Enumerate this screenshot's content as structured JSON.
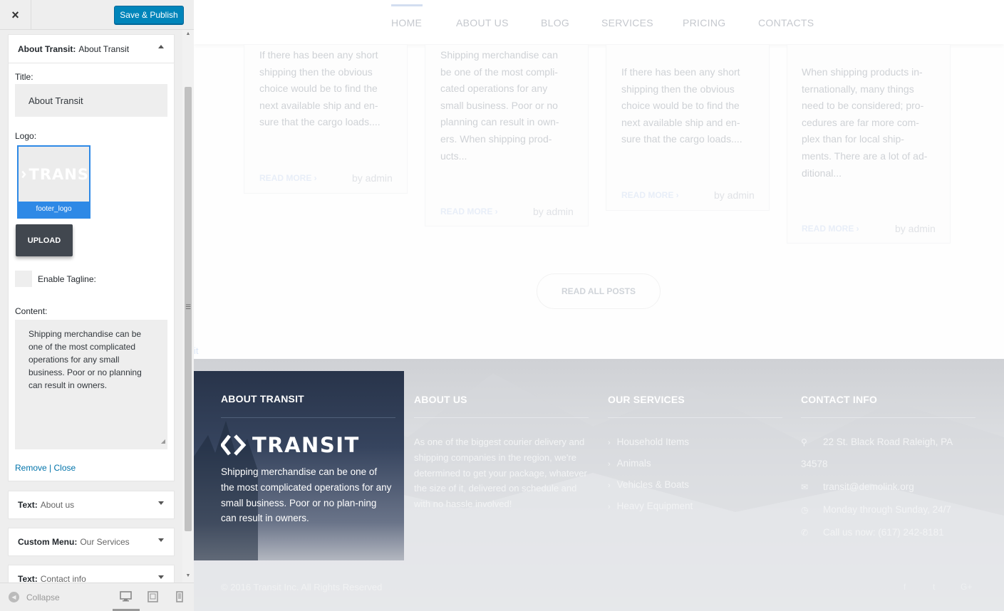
{
  "sidebar": {
    "close_label": "×",
    "publish_label": "Save & Publish",
    "widgets": {
      "about": {
        "type_label": "About Transit:",
        "name": "About Transit",
        "title_label": "Title:",
        "title_value": "About Transit",
        "logo_label": "Logo:",
        "logo_filename": "footer_logo",
        "logo_preview_text": "TRANS",
        "upload_label": "UPLOAD",
        "tagline_label": "Enable Tagline:",
        "tagline_checked": false,
        "content_label": "Content:",
        "content_value": "Shipping merchandise can be one of the most complicated operations for any small business. Poor or no planning can result in owners.",
        "remove_label": "Remove",
        "separator": "|",
        "close_label": "Close"
      },
      "text_about": {
        "type_label": "Text:",
        "name": "About us"
      },
      "custom_menu": {
        "type_label": "Custom Menu:",
        "name": "Our Services"
      },
      "text_contact": {
        "type_label": "Text:",
        "name": "Contact info"
      }
    },
    "collapse_label": "Collapse",
    "devices": [
      "desktop-icon",
      "tablet-icon",
      "mobile-icon"
    ]
  },
  "preview": {
    "nav": [
      "HOME",
      "ABOUT US",
      "BLOG",
      "SERVICES",
      "PRICING",
      "CONTACTS"
    ],
    "nav_active": "HOME",
    "posts": [
      {
        "lines": [
          "If there has been any short",
          "shipping then the obvious",
          "choice would be to find the",
          "next available ship and en-",
          "sure that the cargo loads...."
        ],
        "read_more": "READ MORE",
        "author": "by admin"
      },
      {
        "lines": [
          "Shipping merchandise can",
          "be one of the most compli-",
          "cated operations for any",
          "small business. Poor or no",
          "planning can result in own-",
          "ers. When shipping prod-",
          "ucts..."
        ],
        "read_more": "READ MORE",
        "author": "by admin"
      },
      {
        "lines": [
          "If there has been any short",
          "shipping then the obvious",
          "choice would be to find the",
          "next available ship and en-",
          "sure that the cargo loads...."
        ],
        "read_more": "READ MORE",
        "author": "by admin"
      },
      {
        "lines": [
          "When shipping products in-",
          "ternationally, many things",
          "need to be considered; pro-",
          "cedures are far more com-",
          "plex than for local ship-",
          "ments. There are a lot of ad-",
          "ditional..."
        ],
        "read_more": "READ MORE",
        "author": "by admin"
      }
    ],
    "read_all": "READ ALL POSTS",
    "stray_link": "it",
    "footer": {
      "about_title": "ABOUT TRANSIT",
      "logo_text": "TRANSIT",
      "about_text": "Shipping merchandise can be one of the most complicated operations for any small business. Poor or no plan-ning can result in owners.",
      "aboutus_title": "ABOUT US",
      "aboutus_text": "As one of the biggest courier delivery and shipping companies in the region, we're determined to get your package, whatever the size of it, delivered on schedule and with no hassle involved!",
      "services_title": "OUR SERVICES",
      "services": [
        "Household Items",
        "Animals",
        "Vehicles & Boats",
        "Heavy Equipment"
      ],
      "contact_title": "CONTACT INFO",
      "address_line1": "22 St. Black Road Raleigh, PA",
      "address_line2": "34578",
      "email": "transit@demolink.org",
      "hours": "Monday through Sunday, 24/7",
      "phone": "Call us now: (617) 242-8181",
      "copyright": "© 2016 Transit Inc. All Rights Reserved",
      "socials": [
        "f",
        "t",
        "G+"
      ]
    }
  },
  "colors": {
    "accent": "#0085ba",
    "logo_blue": "#2e89e6",
    "upload_dark": "#41474f",
    "footer_box": "#28344a"
  }
}
